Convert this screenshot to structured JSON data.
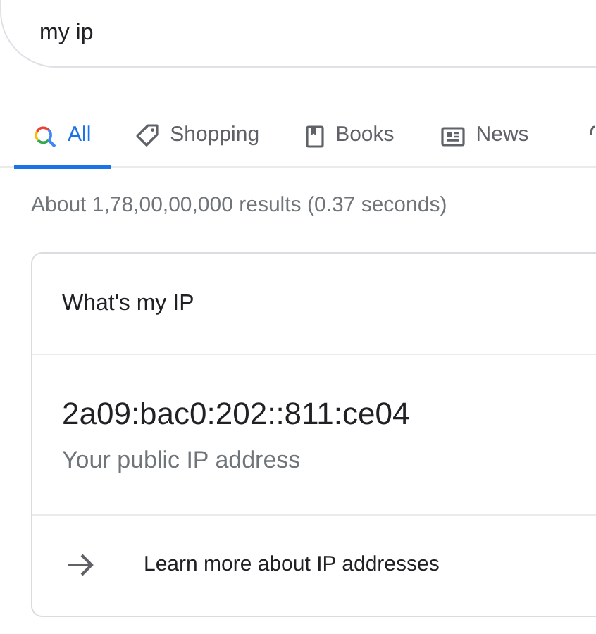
{
  "search": {
    "value": "my ip"
  },
  "tabs": [
    {
      "label": "All",
      "kind": "all",
      "selected": true
    },
    {
      "label": "Shopping",
      "kind": "tag",
      "selected": false
    },
    {
      "label": "Books",
      "kind": "book",
      "selected": false
    },
    {
      "label": "News",
      "kind": "news",
      "selected": false
    }
  ],
  "result_stats": "About 1,78,00,00,000 results (0.37 seconds)",
  "card": {
    "title": "What's my IP",
    "ip": "2a09:bac0:202::811:ce04",
    "caption": "Your public IP address",
    "link": "Learn more about IP addresses"
  }
}
